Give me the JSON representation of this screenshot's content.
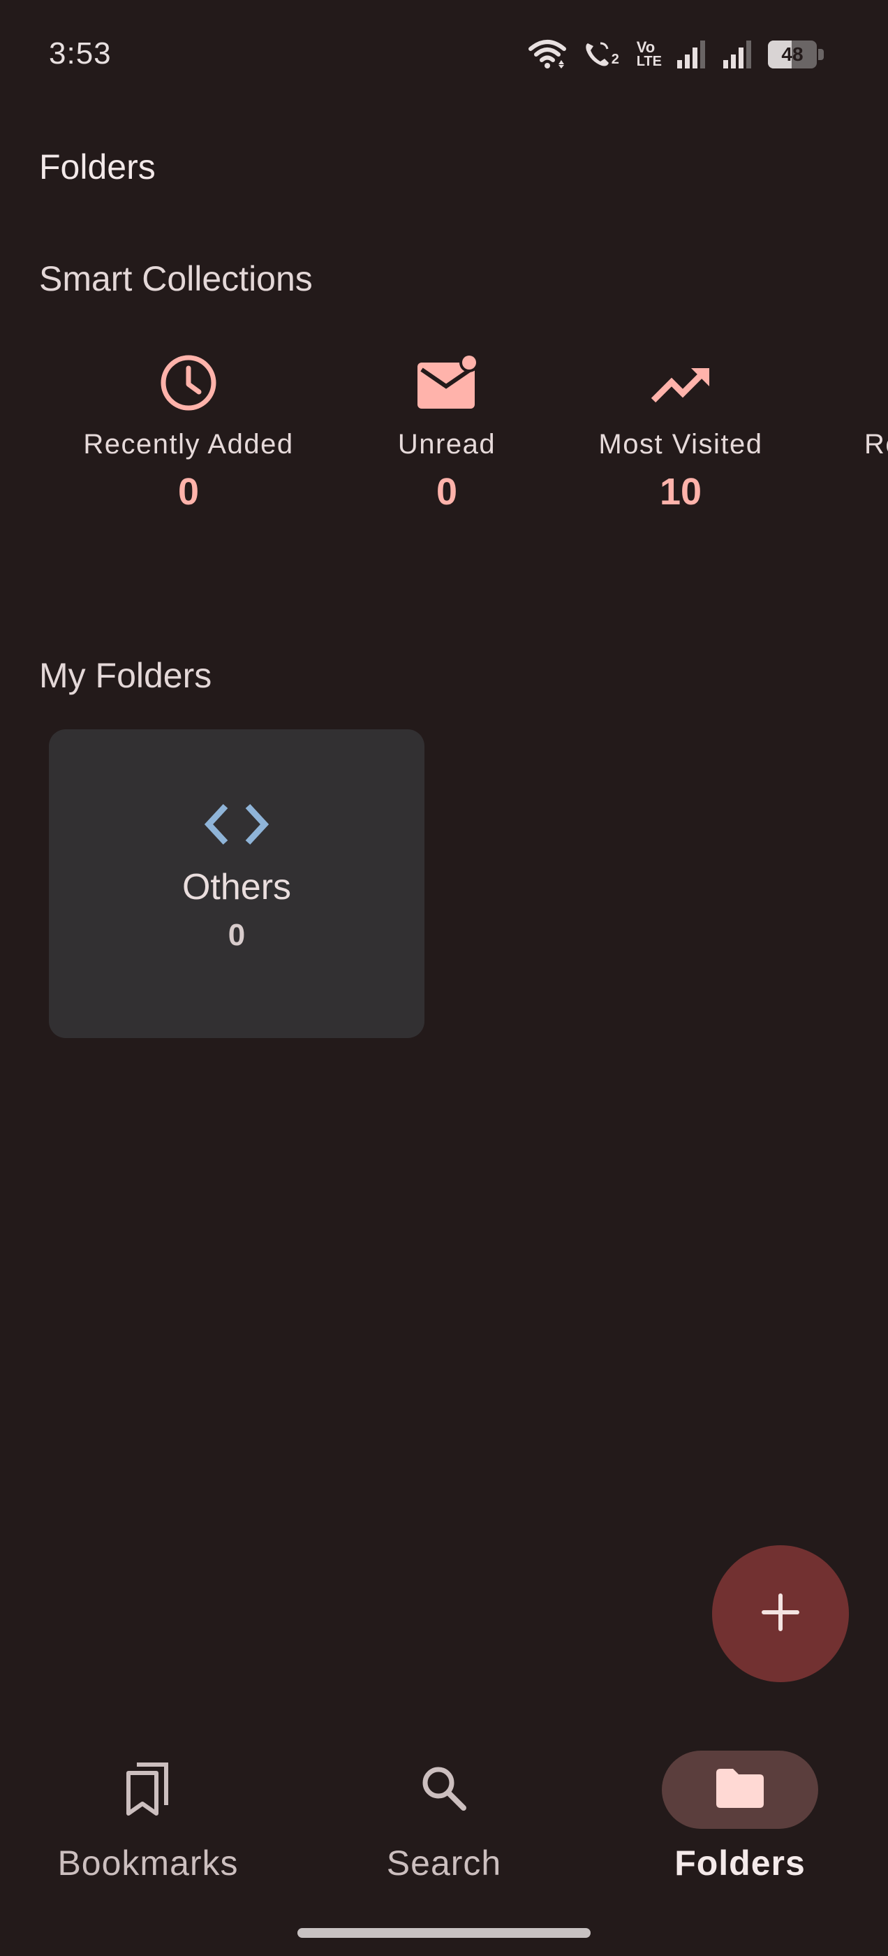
{
  "status_bar": {
    "time": "3:53",
    "battery": "48",
    "battery_percent": 48,
    "icons": [
      "wifi-icon",
      "wifi-calling-icon",
      "volte-icon",
      "signal-icon",
      "signal-icon",
      "battery-icon"
    ],
    "volte_top": "Vo",
    "volte_bottom": "LTE",
    "call_badge": "2"
  },
  "header": {
    "title": "Folders"
  },
  "smart_collections": {
    "title": "Smart Collections",
    "items": [
      {
        "label": "Recently Added",
        "count": "0",
        "icon": "clock-icon"
      },
      {
        "label": "Unread",
        "count": "0",
        "icon": "mail-unread-icon"
      },
      {
        "label": "Most Visited",
        "count": "10",
        "icon": "trending-up-icon"
      },
      {
        "label": "Re",
        "icon": "collection-icon"
      }
    ]
  },
  "my_folders": {
    "title": "My Folders",
    "folders": [
      {
        "name": "Others",
        "count": "0",
        "icon": "code-icon"
      }
    ]
  },
  "fab": {
    "icon": "plus-icon"
  },
  "bottom_nav": {
    "items": [
      {
        "label": "Bookmarks",
        "icon": "bookmarks-icon",
        "active": false
      },
      {
        "label": "Search",
        "icon": "search-icon",
        "active": false
      },
      {
        "label": "Folders",
        "icon": "folder-icon",
        "active": true
      }
    ]
  },
  "colors": {
    "background": "#231a1a",
    "accent": "#ffb3ab",
    "card": "#323032",
    "fab": "#723131",
    "nav_active_pill": "#5b3e3d",
    "code_icon": "#8fb4d8"
  }
}
